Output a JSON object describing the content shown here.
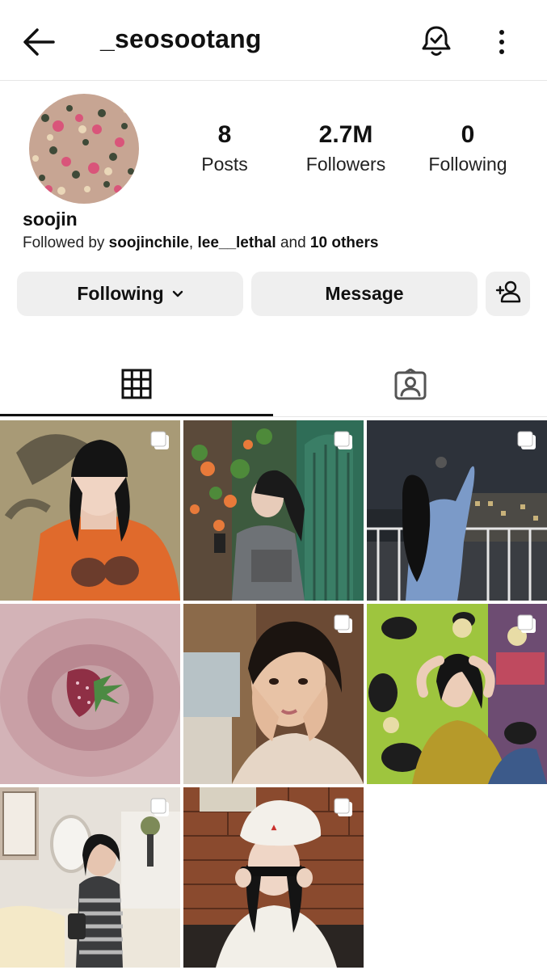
{
  "header": {
    "username": "_seosootang"
  },
  "profile": {
    "display_name": "soojin",
    "stats": [
      {
        "value": "8",
        "label": "Posts"
      },
      {
        "value": "2.7M",
        "label": "Followers"
      },
      {
        "value": "0",
        "label": "Following"
      }
    ],
    "followed_by_prefix": "Followed by",
    "followed_by_user1": "soojinchile",
    "followed_by_sep": ",",
    "followed_by_user2": "lee__lethal",
    "followed_by_and": "and",
    "followed_by_others": "10 others"
  },
  "actions": {
    "following_label": "Following",
    "message_label": "Message"
  },
  "tabs": [
    {
      "icon": "grid-icon",
      "active": true
    },
    {
      "icon": "tagged-icon",
      "active": false
    }
  ],
  "posts": [
    {
      "icon": "multi-post-icon"
    },
    {
      "icon": "multi-post-icon"
    },
    {
      "icon": "multi-post-icon"
    },
    {
      "icon": ""
    },
    {
      "icon": "multi-post-icon"
    },
    {
      "icon": "multi-post-icon"
    },
    {
      "icon": "multi-post-icon"
    },
    {
      "icon": "multi-post-icon"
    }
  ],
  "colors": {
    "text": "#111111",
    "button_bg": "#efefef",
    "divider": "#e6e6e6"
  }
}
